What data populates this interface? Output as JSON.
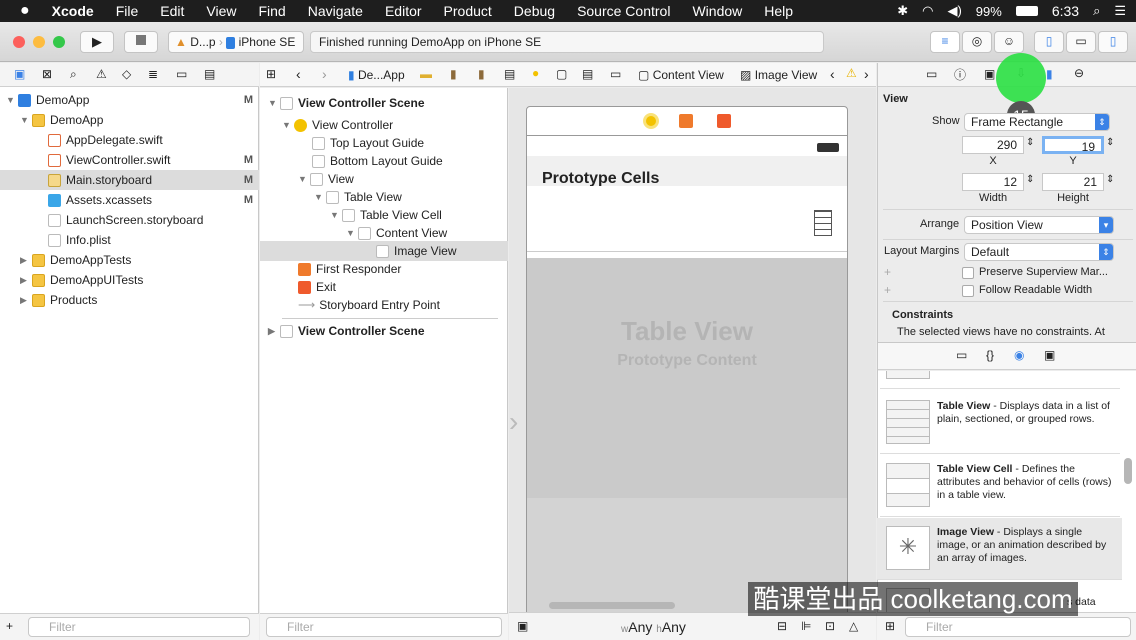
{
  "menubar": {
    "apple": "",
    "app": "Xcode",
    "items": [
      "File",
      "Edit",
      "View",
      "Find",
      "Navigate",
      "Editor",
      "Product",
      "Debug",
      "Source Control",
      "Window",
      "Help"
    ],
    "battery": "99%",
    "time": "6:33"
  },
  "toolbar": {
    "scheme_short": "D...p",
    "device": "iPhone SE",
    "status": "Finished running DemoApp on iPhone SE"
  },
  "navigator": {
    "rows": [
      {
        "label": "DemoApp",
        "badge": "M"
      },
      {
        "label": "DemoApp",
        "badge": ""
      },
      {
        "label": "AppDelegate.swift",
        "badge": ""
      },
      {
        "label": "ViewController.swift",
        "badge": "M"
      },
      {
        "label": "Main.storyboard",
        "badge": "M"
      },
      {
        "label": "Assets.xcassets",
        "badge": "M"
      },
      {
        "label": "LaunchScreen.storyboard",
        "badge": ""
      },
      {
        "label": "Info.plist",
        "badge": ""
      },
      {
        "label": "DemoAppTests",
        "badge": ""
      },
      {
        "label": "DemoAppUITests",
        "badge": ""
      },
      {
        "label": "Products",
        "badge": ""
      }
    ],
    "filter_placeholder": "Filter"
  },
  "jumpbar": {
    "project": "De...App",
    "content_view": "Content View",
    "image_view": "Image View"
  },
  "outline": {
    "rows": [
      "View Controller Scene",
      "View Controller",
      "Top Layout Guide",
      "Bottom Layout Guide",
      "View",
      "Table View",
      "Table View Cell",
      "Content View",
      "Image View",
      "First Responder",
      "Exit",
      "Storyboard Entry Point",
      "View Controller Scene"
    ],
    "filter_placeholder": "Filter"
  },
  "canvas": {
    "prototype_cells": "Prototype Cells",
    "table_view": "Table View",
    "prototype_content": "Prototype Content",
    "size_w": "Any",
    "size_h": "Any",
    "size_w_prefix": "w",
    "size_h_prefix": "h"
  },
  "inspector": {
    "badge": "15",
    "section": "View",
    "show_label": "Show",
    "show_value": "Frame Rectangle",
    "x_value": "290",
    "y_value": "19",
    "x_label": "X",
    "y_label": "Y",
    "width_value": "12",
    "height_value": "21",
    "width_label": "Width",
    "height_label": "Height",
    "arrange_label": "Arrange",
    "arrange_value": "Position View",
    "margins_label": "Layout Margins",
    "margins_value": "Default",
    "preserve": "Preserve Superview Mar...",
    "readable": "Follow Readable Width",
    "constraints_title": "Constraints",
    "constraints_text": "The selected views have no constraints. At"
  },
  "library": {
    "items": [
      {
        "title": "Table View",
        "desc": " - Displays data in a list of plain, sectioned, or grouped rows."
      },
      {
        "title": "Table View Cell",
        "desc": " - Defines the attributes and behavior of cells (rows) in a table view."
      },
      {
        "title": "Image View",
        "desc": " - Displays a single image, or an animation described by an array of images."
      }
    ],
    "partial": "s data",
    "filter_placeholder": "Filter"
  },
  "watermark": "酷课堂出品 coolketang.com",
  "colors": {
    "accent": "#3b82e6",
    "selection": "#dcdcdc",
    "highlight_circle": "#2edf45"
  }
}
